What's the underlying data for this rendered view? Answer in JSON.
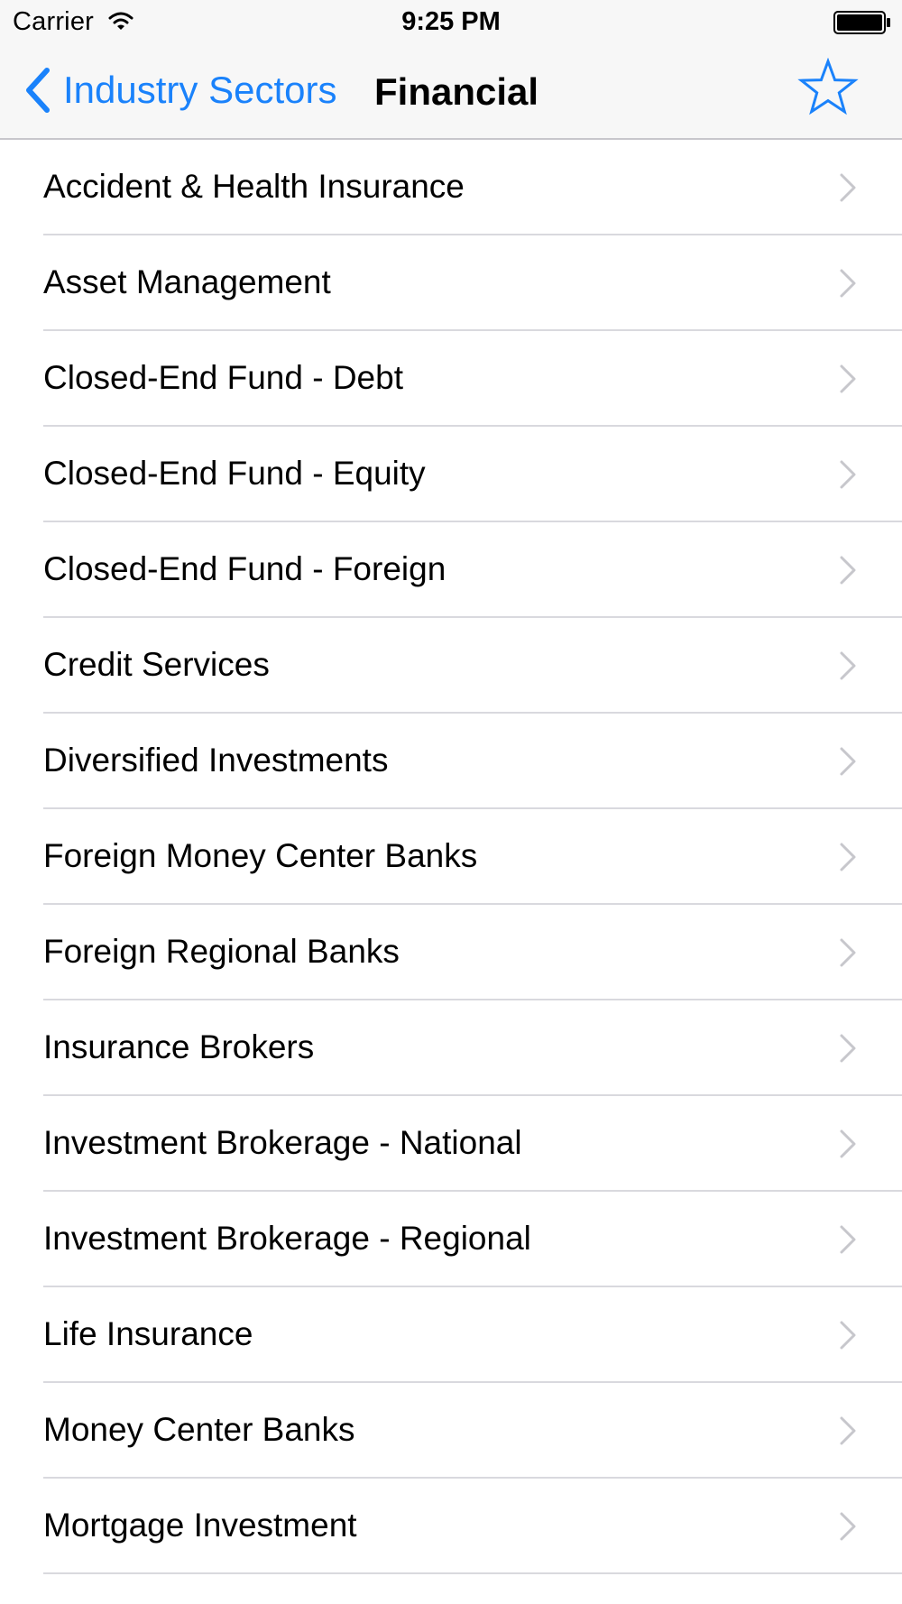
{
  "status_bar": {
    "carrier": "Carrier",
    "time": "9:25 PM",
    "icons": [
      "wifi-icon",
      "battery-icon"
    ]
  },
  "nav_bar": {
    "back_label": "Industry Sectors",
    "title": "Financial",
    "right_icon": "star-icon"
  },
  "colors": {
    "accent": "#1a82fb",
    "bar_background": "#f7f7f7",
    "separator": "#d9d9de",
    "chevron": "#c7c7cc"
  },
  "industries": [
    "Accident & Health Insurance",
    "Asset Management",
    "Closed-End Fund - Debt",
    "Closed-End Fund - Equity",
    "Closed-End Fund - Foreign",
    "Credit Services",
    "Diversified Investments",
    "Foreign Money Center Banks",
    "Foreign Regional Banks",
    "Insurance Brokers",
    "Investment Brokerage - National",
    "Investment Brokerage - Regional",
    "Life Insurance",
    "Money Center Banks",
    "Mortgage Investment"
  ]
}
